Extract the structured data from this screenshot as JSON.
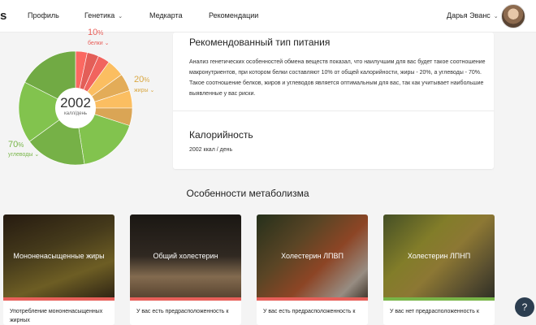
{
  "nav": {
    "logo_fragment": "s",
    "items": [
      {
        "label": "Профиль",
        "has_dropdown": false
      },
      {
        "label": "Генетика",
        "has_dropdown": true
      },
      {
        "label": "Медкарта",
        "has_dropdown": false
      },
      {
        "label": "Рекомендации",
        "has_dropdown": false
      }
    ],
    "user_name": "Дарья Эванс"
  },
  "chart_data": {
    "type": "pie",
    "center_value": "2002",
    "center_unit": "калл/день",
    "slices": [
      {
        "name": "белки",
        "value": 10,
        "color": "#e8605a"
      },
      {
        "name": "жиры",
        "value": 20,
        "color": "#e8b05a"
      },
      {
        "name": "углеводы",
        "value": 70,
        "color": "#78b548"
      }
    ],
    "legend": [
      {
        "pct": "10",
        "pct_unit": "%",
        "label": "белки",
        "color": "#e8605a"
      },
      {
        "pct": "20",
        "pct_unit": "%",
        "label": "жиры",
        "color": "#d9a844"
      },
      {
        "pct": "70",
        "pct_unit": "%",
        "label": "углеводы",
        "color": "#78b548"
      }
    ]
  },
  "card": {
    "title": "Рекомендованный тип питания",
    "text": "Анализ генетических особенностей обмена веществ показал, что наилучшим для вас будет такое соотношение макронутриентов, при котором белки составляют 10% от общей калорийности, жиры - 20%, а углеводы - 70%. Такое соотношение белков, жиров и углеводов является оптимальным для вас, так как учитывает наибольшие выявленные у вас риски.",
    "calories_title": "Калорийность",
    "calories_value": "2002 ккал / день"
  },
  "metabolism": {
    "title": "Особенности метаболизма",
    "tiles": [
      {
        "title": "Мононенасыщенные жиры",
        "desc": "Употребление мононенасыщенных жирных",
        "bar_color": "#e8605a"
      },
      {
        "title": "Общий холестерин",
        "desc": "У вас есть предрасположенность к",
        "bar_color": "#e8605a"
      },
      {
        "title": "Холестерин ЛПВП",
        "desc": "У вас есть предрасположенность к",
        "bar_color": "#e8605a"
      },
      {
        "title": "Холестерин ЛПНП",
        "desc": "У вас нет предрасположенность к",
        "bar_color": "#78b548"
      }
    ]
  },
  "help": {
    "icon": "chat-question-icon",
    "glyph": "?"
  }
}
